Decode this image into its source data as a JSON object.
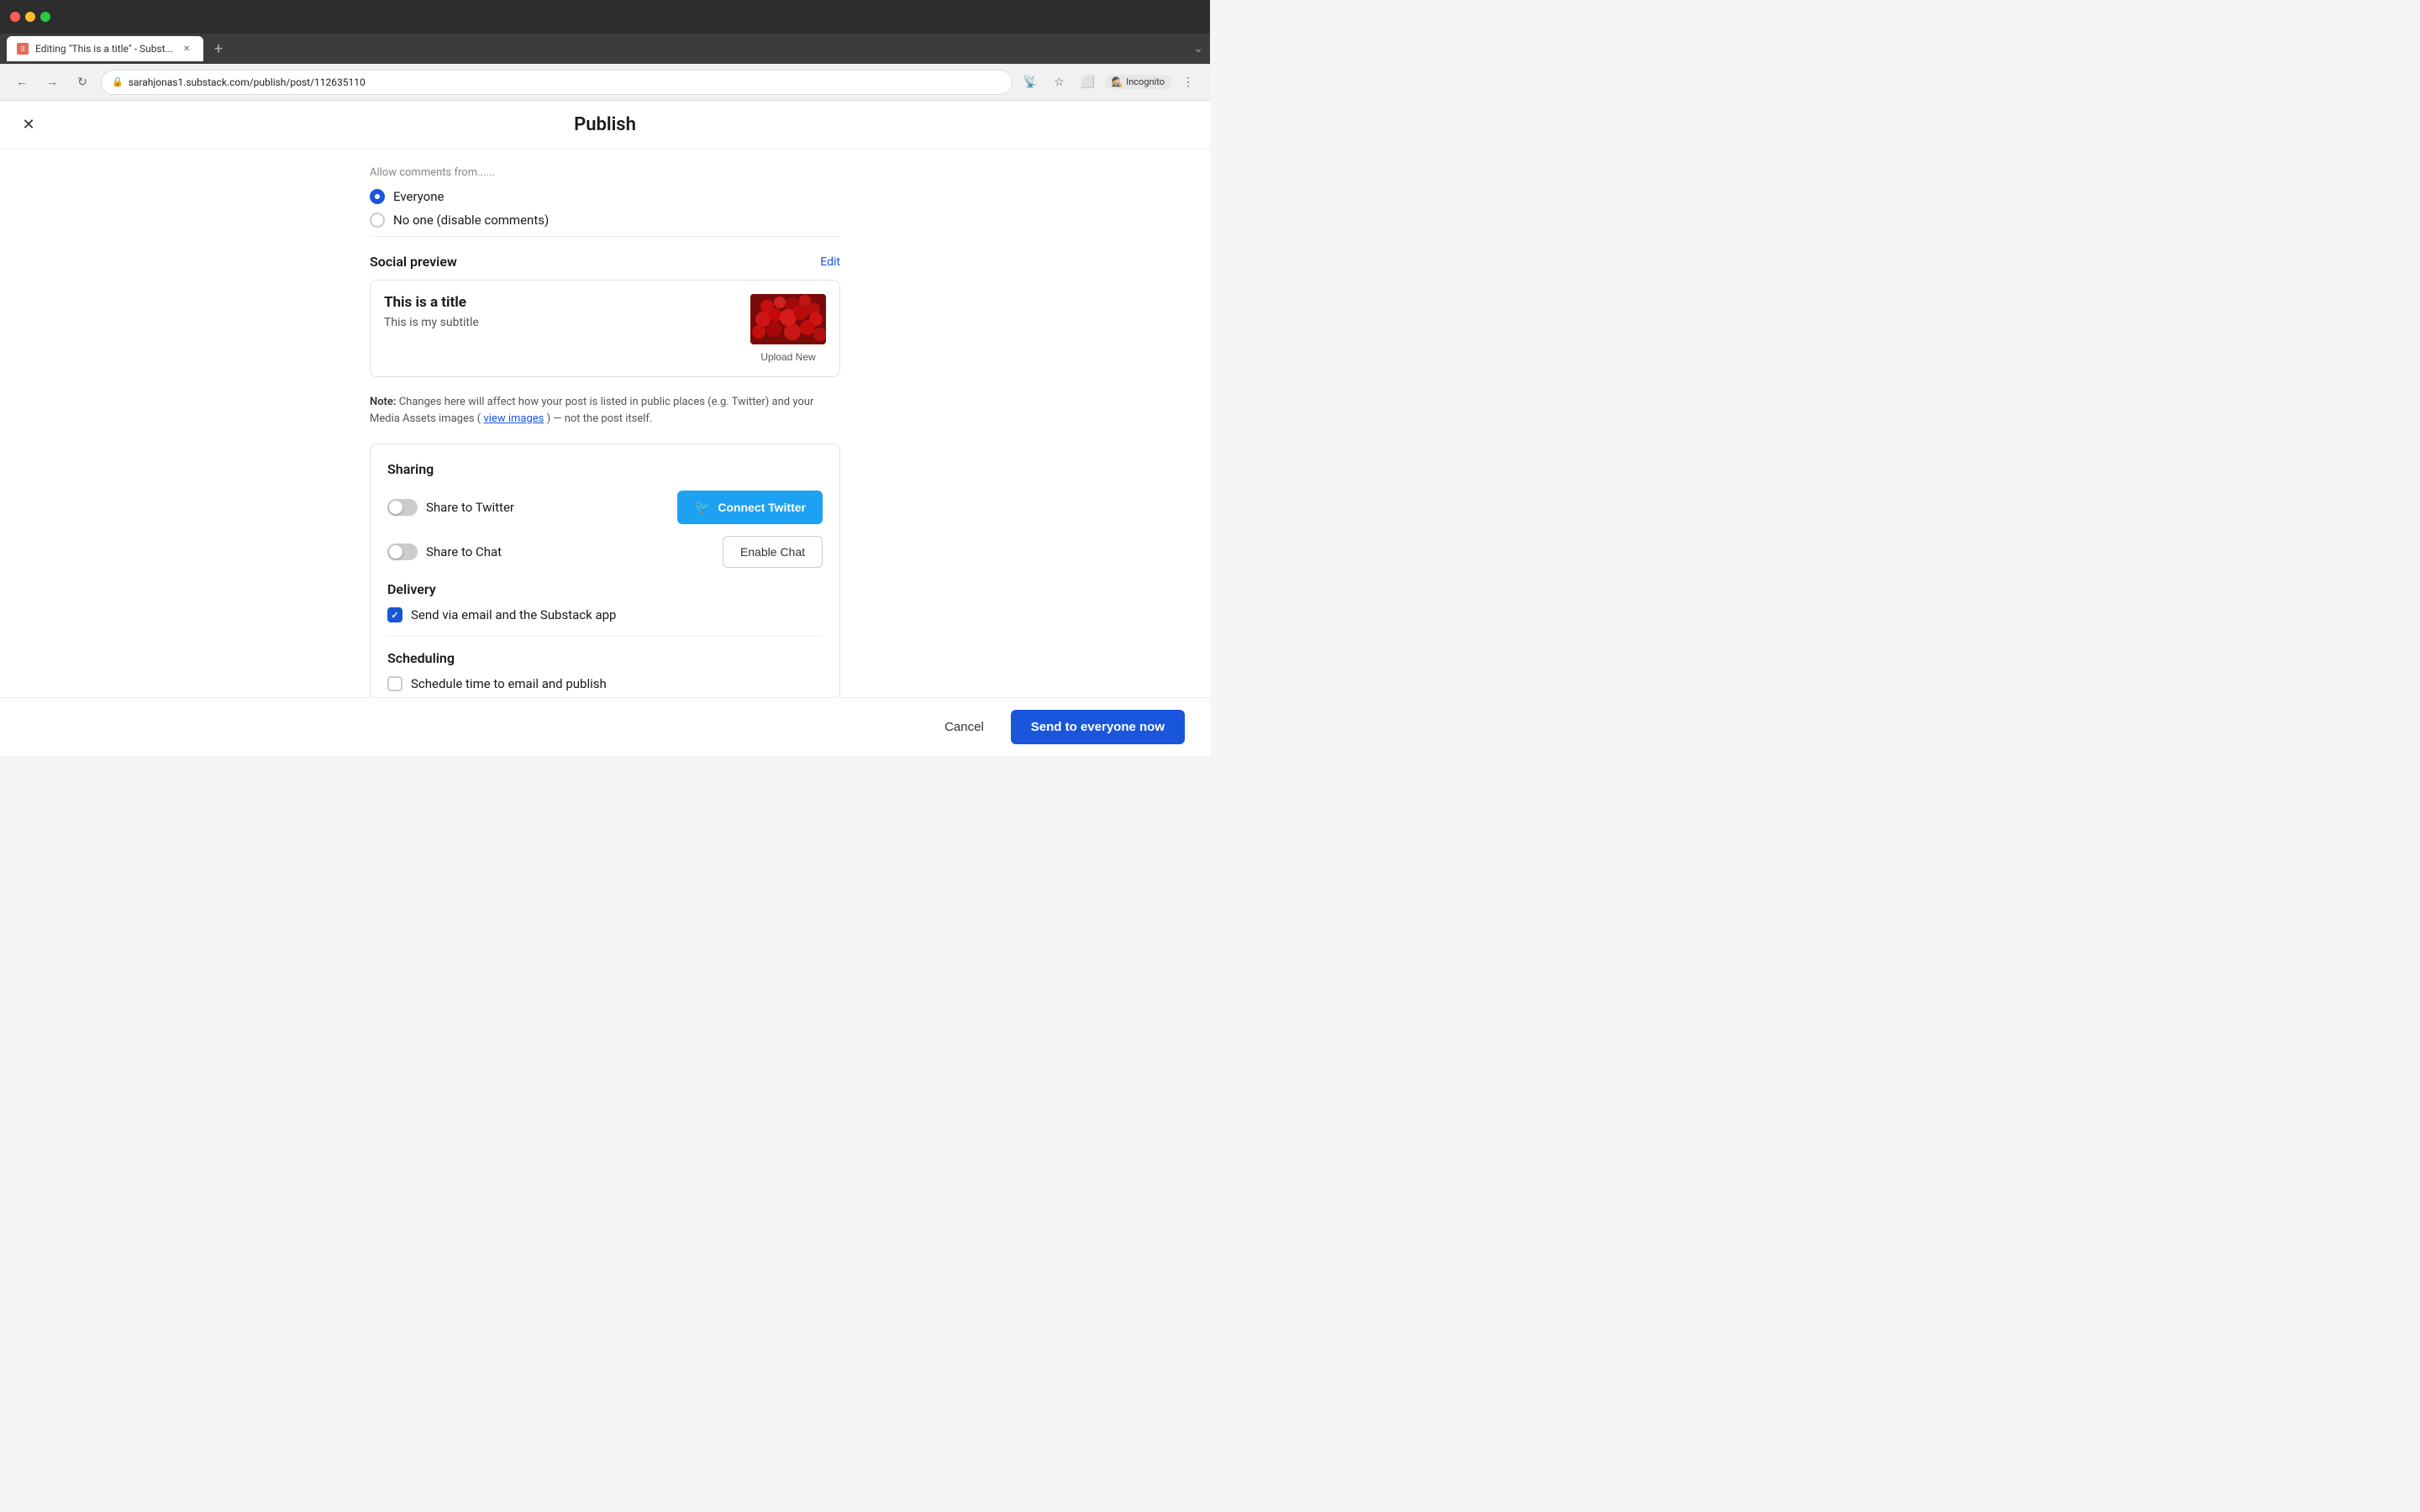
{
  "browser": {
    "tab_title": "Editing \"This is a title\" - Subst...",
    "url": "sarahjonas1.substack.com/publish/post/112635110",
    "new_tab_label": "+",
    "incognito_label": "Incognito",
    "tab_overflow": "⌄"
  },
  "header": {
    "title": "Publish",
    "close_icon": "✕"
  },
  "comments": {
    "section_label": "Allow comments from......",
    "everyone_label": "Everyone",
    "no_one_label": "No one (disable comments)"
  },
  "social_preview": {
    "section_title": "Social preview",
    "edit_label": "Edit",
    "post_title": "This is a title",
    "post_subtitle": "This is my subtitle",
    "upload_new_label": "Upload New"
  },
  "note": {
    "prefix": "Note:",
    "text": " Changes here will affect how your post is listed in public places (e.g. Twitter) and your Media Assets images (",
    "link": "view images",
    "suffix": ") — not the post itself."
  },
  "sharing": {
    "section_title": "Sharing",
    "twitter_label": "Share to Twitter",
    "chat_label": "Share to Chat",
    "connect_twitter_label": "Connect Twitter",
    "enable_chat_label": "Enable Chat",
    "twitter_icon": "🐦"
  },
  "delivery": {
    "section_title": "Delivery",
    "send_label": "Send via email and the Substack app"
  },
  "scheduling": {
    "section_title": "Scheduling",
    "schedule_label": "Schedule time to email and publish"
  },
  "footer": {
    "cancel_label": "Cancel",
    "send_label": "Send to everyone now"
  }
}
